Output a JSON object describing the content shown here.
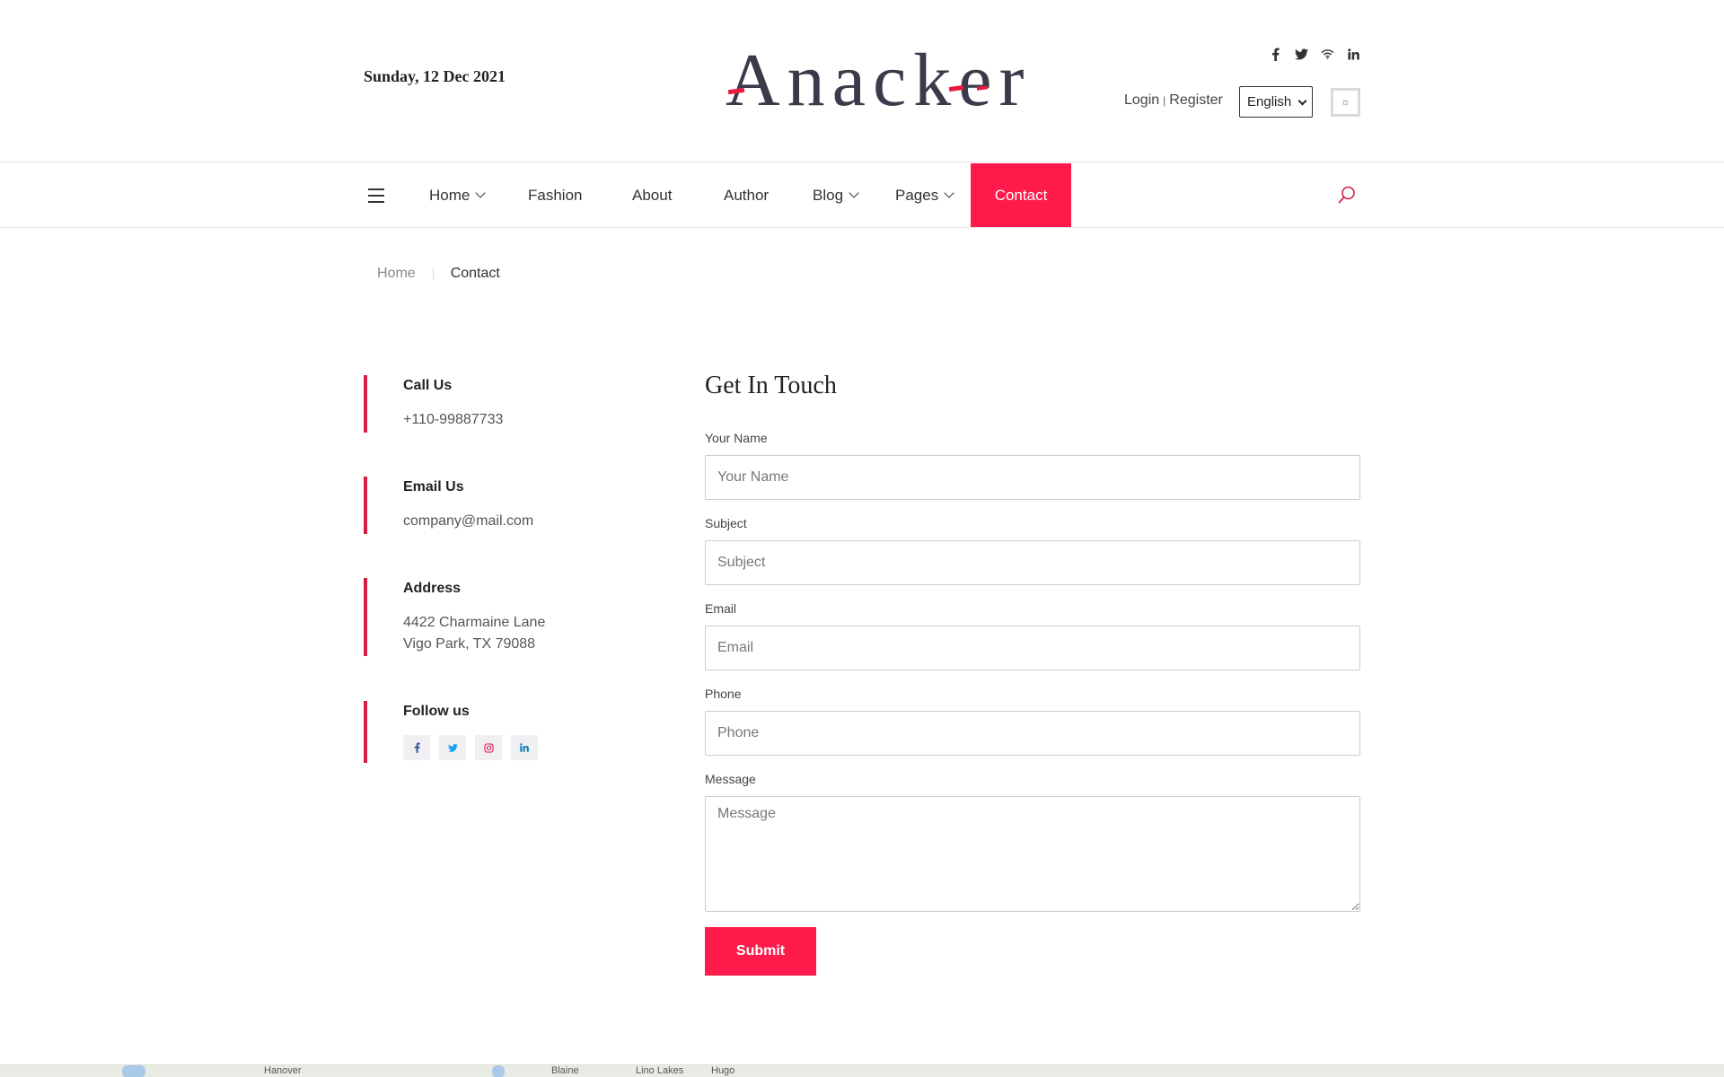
{
  "header": {
    "date": "Sunday, 12 Dec 2021",
    "logo_text": "Anacker",
    "social_icons": [
      {
        "name": "facebook-icon",
        "glyph": "f"
      },
      {
        "name": "twitter-icon",
        "glyph": "t"
      },
      {
        "name": "wifi-icon",
        "glyph": "w"
      },
      {
        "name": "linkedin-icon",
        "glyph": "in"
      }
    ],
    "login": "Login",
    "auth_separator": "|",
    "register": "Register",
    "language": "English",
    "theme_toggle_glyph": "☼"
  },
  "nav": {
    "items": [
      {
        "label": "Home",
        "dropdown": true
      },
      {
        "label": "Fashion",
        "dropdown": false
      },
      {
        "label": "About",
        "dropdown": false
      },
      {
        "label": "Author",
        "dropdown": false
      },
      {
        "label": "Blog",
        "dropdown": true
      },
      {
        "label": "Pages",
        "dropdown": true
      },
      {
        "label": "Contact",
        "dropdown": false,
        "active": true
      }
    ],
    "active_color": "#fe1a4a"
  },
  "breadcrumb": {
    "home": "Home",
    "current": "Contact"
  },
  "contact_info": {
    "call": {
      "title": "Call Us",
      "value": "+110-99887733"
    },
    "email": {
      "title": "Email Us",
      "value": "company@mail.com"
    },
    "address": {
      "title": "Address",
      "line1": "4422 Charmaine Lane",
      "line2": "Vigo Park, TX 79088"
    },
    "follow": {
      "title": "Follow us",
      "icons": [
        {
          "name": "facebook-icon",
          "glyph": "f",
          "color": "#3b5998"
        },
        {
          "name": "twitter-icon",
          "glyph": "t",
          "color": "#1da1f2"
        },
        {
          "name": "instagram-icon",
          "glyph": "◎",
          "color": "#e1306c"
        },
        {
          "name": "linkedin-icon",
          "glyph": "in",
          "color": "#0077b5"
        }
      ]
    },
    "accent_color": "#d81d45"
  },
  "form": {
    "title": "Get In Touch",
    "name_label": "Your Name",
    "name_placeholder": "Your Name",
    "subject_label": "Subject",
    "subject_placeholder": "Subject",
    "email_label": "Email",
    "email_placeholder": "Email",
    "phone_label": "Phone",
    "phone_placeholder": "Phone",
    "message_label": "Message",
    "message_placeholder": "Message",
    "submit_label": "Submit"
  },
  "map": {
    "labels": [
      "Hanover",
      "Blaine",
      "Lino Lakes",
      "Hugo"
    ]
  }
}
